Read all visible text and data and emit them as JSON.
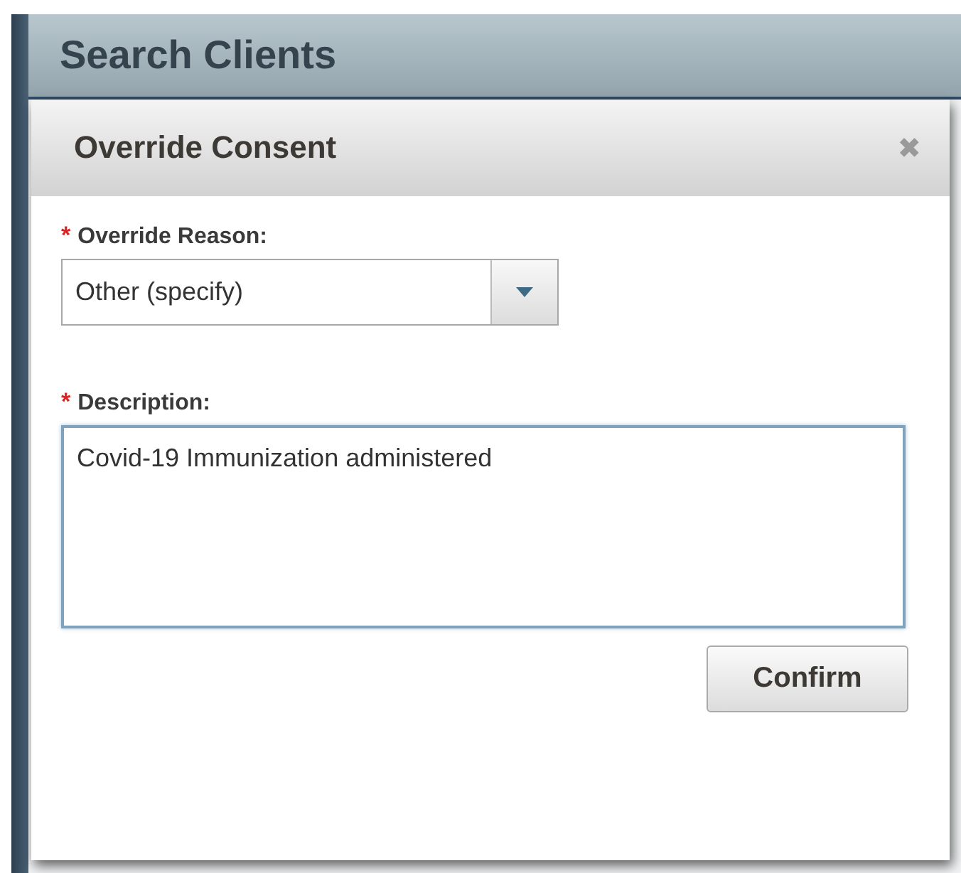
{
  "page": {
    "title": "Search Clients"
  },
  "dialog": {
    "title": "Override Consent",
    "close": "✖",
    "fields": [
      {
        "kind": "select",
        "label": "Override Reason:",
        "required_mark": "*",
        "value": "Other (specify)"
      },
      {
        "kind": "textarea",
        "label": "Description:",
        "required_mark": "*",
        "value": "Covid-19 Immunization administered"
      }
    ],
    "buttons": [
      "Confirm"
    ]
  }
}
